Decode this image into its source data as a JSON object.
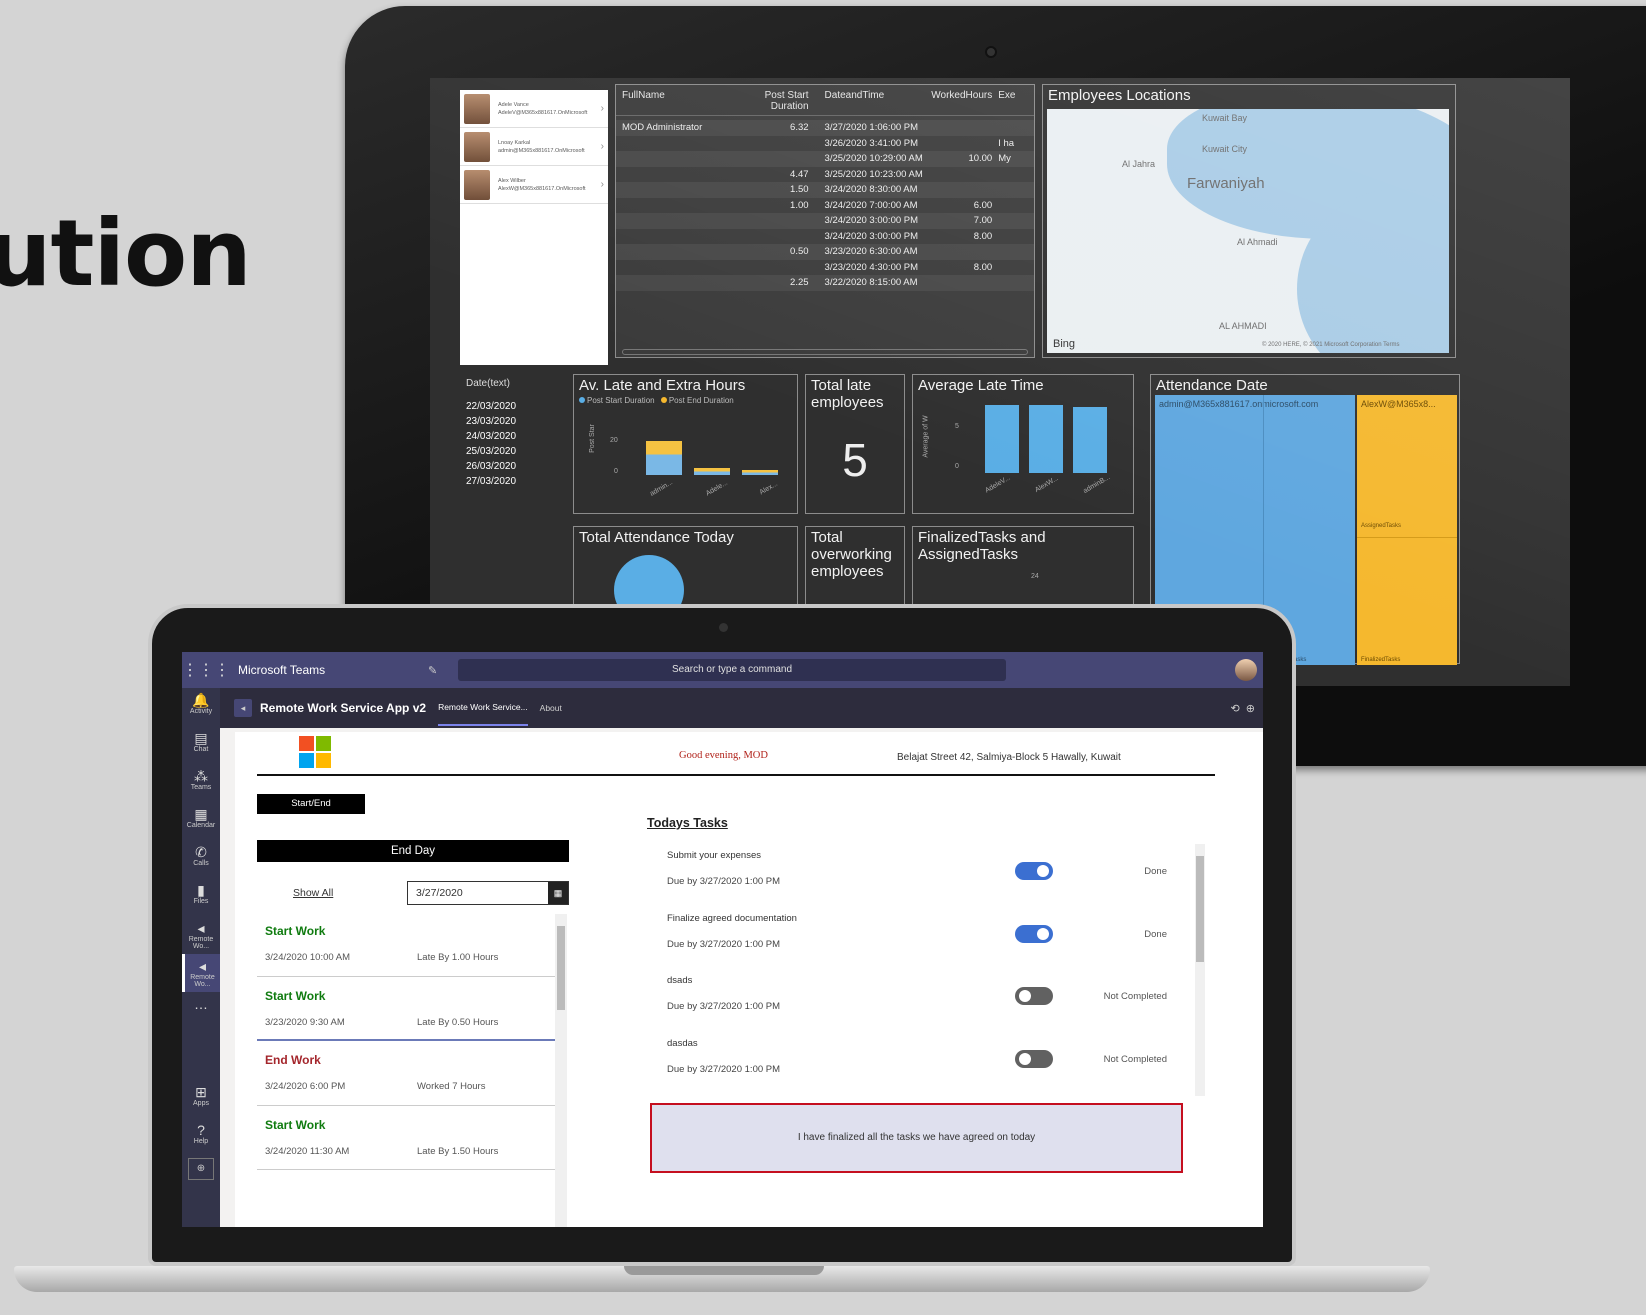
{
  "slide": {
    "title_fragment": "ution"
  },
  "dashboard": {
    "users": [
      {
        "name": "Adele Vance",
        "email": "AdeleV@M365x881617.OnMicrosoft"
      },
      {
        "name": "Lnoay Karkal",
        "email": "admin@M365x881617.OnMicrosoft"
      },
      {
        "name": "Alex Wilber",
        "email": "AlexW@M365x881617.OnMicrosoft"
      }
    ],
    "table": {
      "columns": [
        "FullName",
        "Post Start Duration",
        "DateandTime",
        "WorkedHours",
        "Exe"
      ],
      "rows": [
        [
          "MOD Administrator",
          "6.32",
          "3/27/2020 1:06:00 PM",
          "",
          ""
        ],
        [
          "",
          "",
          "3/26/2020 3:41:00 PM",
          "",
          "I ha"
        ],
        [
          "",
          "",
          "3/25/2020 10:29:00 AM",
          "10.00",
          "My"
        ],
        [
          "",
          "4.47",
          "3/25/2020 10:23:00 AM",
          "",
          ""
        ],
        [
          "",
          "1.50",
          "3/24/2020 8:30:00 AM",
          "",
          ""
        ],
        [
          "",
          "1.00",
          "3/24/2020 7:00:00 AM",
          "6.00",
          ""
        ],
        [
          "",
          "",
          "3/24/2020 3:00:00 PM",
          "7.00",
          ""
        ],
        [
          "",
          "",
          "3/24/2020 3:00:00 PM",
          "8.00",
          ""
        ],
        [
          "",
          "0.50",
          "3/23/2020 6:30:00 AM",
          "",
          ""
        ],
        [
          "",
          "",
          "3/23/2020 4:30:00 PM",
          "8.00",
          ""
        ],
        [
          "",
          "2.25",
          "3/22/2020 8:15:00 AM",
          "",
          ""
        ]
      ]
    },
    "map": {
      "title": "Employees Locations",
      "labels": [
        "Kuwait Bay",
        "Kuwait City",
        "Al Jahra",
        "Farwaniyah",
        "Al Ahmadi",
        "AL AHMADI"
      ],
      "bing": "Bing",
      "copyright": "© 2020 HERE, © 2021 Microsoft Corporation Terms"
    },
    "date_slicer": {
      "header": "Date(text)",
      "items": [
        "22/03/2020",
        "23/03/2020",
        "24/03/2020",
        "25/03/2020",
        "26/03/2020",
        "27/03/2020"
      ]
    },
    "late_hours": {
      "title": "Av. Late and Extra Hours",
      "legend": [
        "Post Start Duration",
        "Post End Duration"
      ],
      "ylabel": "Post Star",
      "ticks": [
        "20",
        "0"
      ],
      "categories": [
        "admin...",
        "Adele...",
        "Alex..."
      ]
    },
    "total_late": {
      "title": "Total late employees",
      "value": "5"
    },
    "avg_late": {
      "title": "Average Late Time",
      "ylabel": "Average of W",
      "ticks": [
        "5",
        "0"
      ],
      "categories": [
        "AdeleV...",
        "AlexW...",
        "adminB..."
      ]
    },
    "attendance_date": {
      "title": "Attendance Date",
      "cells": [
        "admin@M365x881617.onmicrosoft.com",
        "AlexW@M365x8...",
        "AssignedTasks",
        "FinalizedTasks",
        "FinalizedTasks"
      ]
    },
    "total_attendance": {
      "title": "Total Attendance Today"
    },
    "total_overworking": {
      "title": "Total overworking employees"
    },
    "finalized": {
      "title": "FinalizedTasks and AssignedTasks",
      "tick": "24"
    }
  },
  "teams": {
    "app_name": "Microsoft Teams",
    "search_placeholder": "Search or type a command",
    "rail": [
      {
        "icon": "🔔",
        "label": "Activity"
      },
      {
        "icon": "▤",
        "label": "Chat"
      },
      {
        "icon": "⁂",
        "label": "Teams"
      },
      {
        "icon": "▦",
        "label": "Calendar"
      },
      {
        "icon": "✆",
        "label": "Calls"
      },
      {
        "icon": "▮",
        "label": "Files"
      },
      {
        "icon": "◂",
        "label": "Remote Wo..."
      },
      {
        "icon": "◂",
        "label": "Remote Wo..."
      },
      {
        "icon": "…",
        "label": ""
      }
    ],
    "rail_bottom": [
      {
        "icon": "⊞",
        "label": "Apps"
      },
      {
        "icon": "?",
        "label": "Help"
      }
    ],
    "header": {
      "app_title": "Remote Work Service App v2",
      "tabs": [
        "Remote Work Service...",
        "About"
      ]
    }
  },
  "app": {
    "greeting": "Good evening, MOD",
    "address": "Belajat Street 42, Salmiya-Block 5 Hawally, Kuwait",
    "start_end_button": "Start/End",
    "end_day_button": "End Day",
    "show_all": "Show All",
    "date_value": "3/27/2020",
    "logs": [
      {
        "type": "Start Work",
        "kind": "start",
        "date": "3/24/2020 10:00 AM",
        "detail": "Late By 1.00 Hours"
      },
      {
        "type": "Start Work",
        "kind": "start",
        "date": "3/23/2020 9:30 AM",
        "detail": "Late By 0.50 Hours"
      },
      {
        "type": "End Work",
        "kind": "end",
        "date": "3/24/2020 6:00 PM",
        "detail": "Worked 7 Hours"
      },
      {
        "type": "Start Work",
        "kind": "start",
        "date": "3/24/2020 11:30 AM",
        "detail": "Late By 1.50 Hours"
      }
    ],
    "tasks_title": "Todays Tasks",
    "tasks": [
      {
        "name": "Submit your expenses",
        "due": "Due by 3/27/2020 1:00 PM",
        "done": true,
        "status": "Done"
      },
      {
        "name": "Finalize agreed documentation",
        "due": "Due by 3/27/2020 1:00 PM",
        "done": true,
        "status": "Done"
      },
      {
        "name": "dsads",
        "due": "Due by 3/27/2020 1:00 PM",
        "done": false,
        "status": "Not Completed"
      },
      {
        "name": "dasdas",
        "due": "Due by 3/27/2020 1:00 PM",
        "done": false,
        "status": "Not Completed"
      }
    ],
    "note": "I have finalized all the tasks we have agreed on today"
  },
  "colors": {
    "teams_purple": "#464775",
    "accent_blue": "#5aaee5",
    "accent_yellow": "#f5b82e",
    "toggle_on": "#3b6fd1",
    "error_red": "#c50f1f"
  }
}
